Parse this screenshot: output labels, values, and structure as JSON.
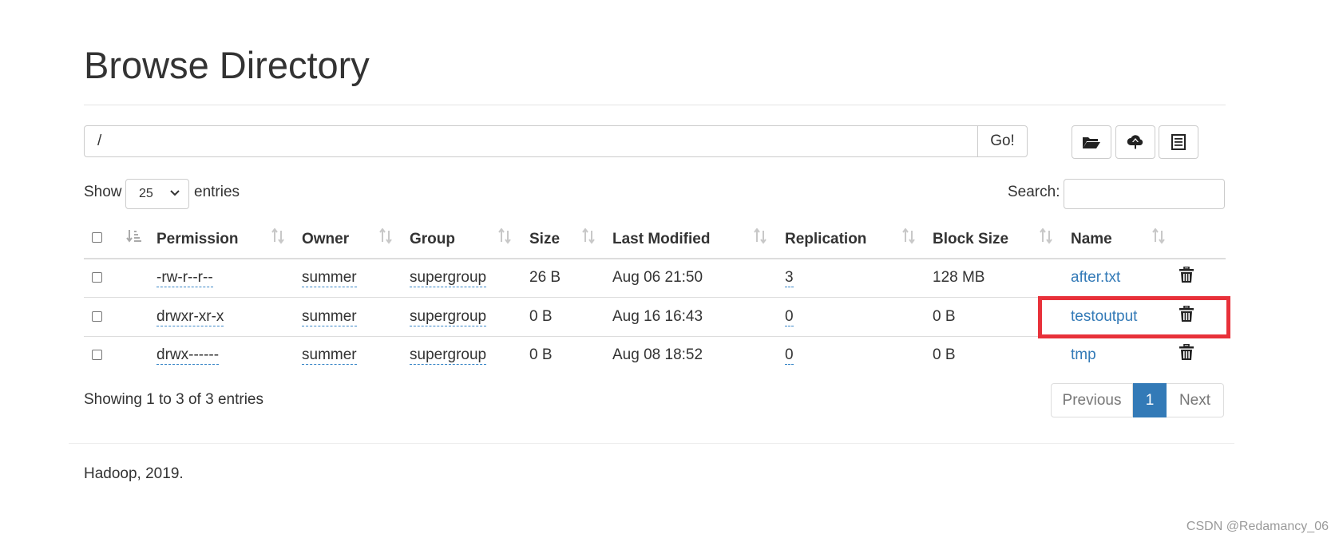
{
  "page": {
    "title": "Browse Directory"
  },
  "pathbar": {
    "value": "/",
    "go_label": "Go!"
  },
  "toolbar": {
    "icons": [
      "folder-open-icon",
      "cloud-upload-icon",
      "list-icon"
    ]
  },
  "length": {
    "show_label": "Show",
    "selected": "25",
    "entries_label": "entries"
  },
  "search": {
    "label": "Search:",
    "value": ""
  },
  "table": {
    "headers": {
      "permission": "Permission",
      "owner": "Owner",
      "group": "Group",
      "size": "Size",
      "last_modified": "Last Modified",
      "replication": "Replication",
      "block_size": "Block Size",
      "name": "Name"
    },
    "rows": [
      {
        "permission": "-rw-r--r--",
        "owner": "summer",
        "group": "supergroup",
        "size": "26 B",
        "last_modified": "Aug 06 21:50",
        "replication": "3",
        "block_size": "128 MB",
        "name": "after.txt"
      },
      {
        "permission": "drwxr-xr-x",
        "owner": "summer",
        "group": "supergroup",
        "size": "0 B",
        "last_modified": "Aug 16 16:43",
        "replication": "0",
        "block_size": "0 B",
        "name": "testoutput"
      },
      {
        "permission": "drwx------",
        "owner": "summer",
        "group": "supergroup",
        "size": "0 B",
        "last_modified": "Aug 08 18:52",
        "replication": "0",
        "block_size": "0 B",
        "name": "tmp"
      }
    ]
  },
  "info": {
    "text": "Showing 1 to 3 of 3 entries"
  },
  "pagination": {
    "previous": "Previous",
    "current": "1",
    "next": "Next"
  },
  "footer": {
    "text": "Hadoop, 2019."
  },
  "watermark": {
    "text": "CSDN @Redamancy_06"
  },
  "colors": {
    "link": "#337ab7",
    "highlight": "#e8313a",
    "active_page": "#337ab7"
  }
}
